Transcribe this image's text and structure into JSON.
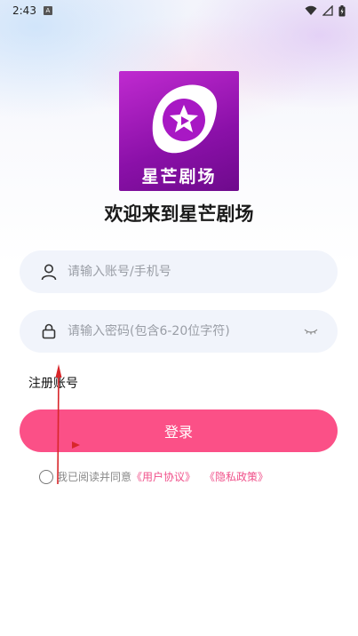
{
  "status_bar": {
    "time": "2:43",
    "badge": "A"
  },
  "logo": {
    "text": "星芒剧场"
  },
  "welcome": "欢迎来到星芒剧场",
  "account_field": {
    "placeholder": "请输入账号/手机号"
  },
  "password_field": {
    "placeholder": "请输入密码(包含6-20位字符)"
  },
  "register_link": "注册账号",
  "login_button": "登录",
  "agreement": {
    "prefix": "我已阅读并同意",
    "user_agreement": "《用户协议》",
    "privacy_policy": "《隐私政策》"
  },
  "colors": {
    "accent": "#fb5087",
    "logo_bg": "#a018c0",
    "field_bg": "#f1f4fb",
    "link": "#f0508a"
  }
}
